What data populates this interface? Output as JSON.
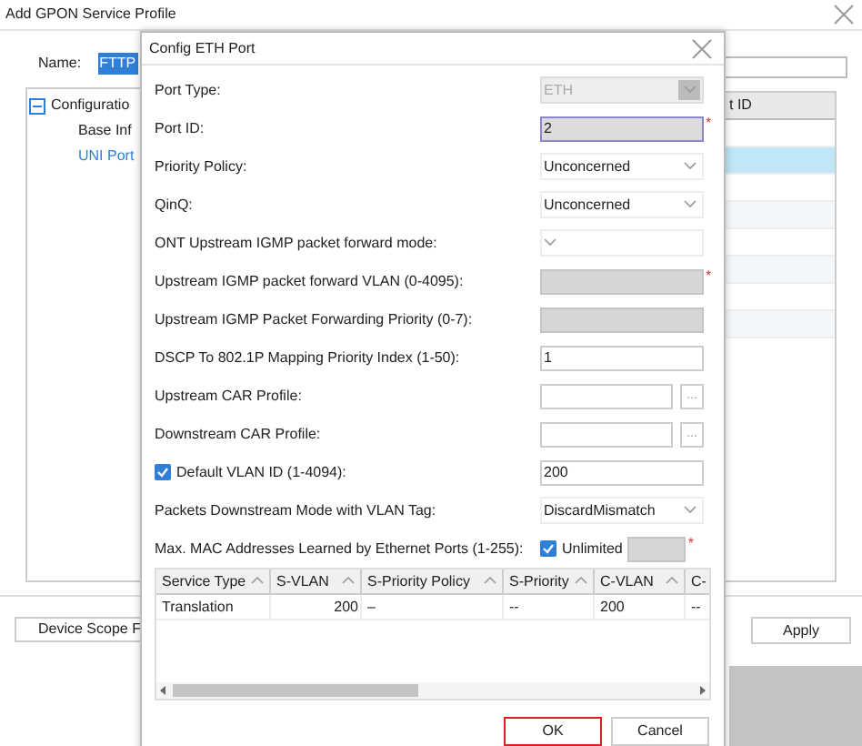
{
  "window": {
    "title": "Add GPON Service Profile"
  },
  "name_field": {
    "label": "Name:",
    "value": "FTTP",
    "selected": true
  },
  "tree": {
    "items": [
      {
        "label": "Configuratio",
        "expanded": true,
        "children": [
          {
            "label": "Base Inf",
            "selected": false
          },
          {
            "label": "UNI Port",
            "selected": true
          }
        ]
      }
    ]
  },
  "port_table": {
    "columns": [
      "t ID"
    ],
    "rows": [
      {
        "selected": false
      },
      {
        "selected": true
      },
      {
        "selected": false
      },
      {
        "selected": false
      },
      {
        "selected": false
      },
      {
        "selected": false
      },
      {
        "selected": false
      },
      {
        "selected": false
      }
    ]
  },
  "buttons": [
    {
      "label": "Device Scope F"
    },
    {
      "label": "Apply"
    }
  ],
  "dialog": {
    "title": "Config ETH Port",
    "fields": [
      {
        "kind": "select",
        "label": "Port Type:",
        "value": "ETH",
        "disabled": true
      },
      {
        "kind": "text",
        "label": "Port ID:",
        "value": "2",
        "disabled": false,
        "focused": true,
        "marker": "*"
      },
      {
        "kind": "select",
        "label": "Priority Policy:",
        "value": "Unconcerned",
        "disabled": false
      },
      {
        "kind": "select",
        "label": "QinQ:",
        "value": "Unconcerned",
        "disabled": false
      },
      {
        "kind": "select",
        "label": "ONT Upstream IGMP packet forward mode:",
        "disabled": false
      },
      {
        "kind": "text",
        "label": "Upstream IGMP packet forward VLAN (0-4095):",
        "disabled": true,
        "marker": "*"
      },
      {
        "kind": "text",
        "label": "Upstream IGMP Packet Forwarding Priority (0-7):",
        "disabled": true
      },
      {
        "kind": "text",
        "label": "DSCP To 802.1P Mapping Priority Index (1-50):",
        "value": "1",
        "disabled": false
      },
      {
        "kind": "browse",
        "label": "Upstream CAR Profile:",
        "button": "...",
        "disabled": false
      },
      {
        "kind": "browse",
        "label": "Downstream CAR Profile:",
        "button": "...",
        "disabled": false
      },
      {
        "kind": "text",
        "label": "Default VLAN ID (1-4094):",
        "value": "200",
        "disabled": false,
        "checked": true
      },
      {
        "kind": "select",
        "label": "Packets Downstream Mode with VLAN Tag:",
        "value": "DiscardMismatch",
        "disabled": false
      },
      {
        "kind": "unlimited",
        "label": "Max. MAC Addresses Learned by Ethernet Ports (1-255):",
        "option": "Unlimited",
        "checked": true,
        "disabled": true,
        "marker": "*"
      }
    ],
    "table": {
      "columns": [
        "Service Type",
        "S-VLAN",
        "S-Priority Policy",
        "S-Priority",
        "C-VLAN",
        "C-"
      ],
      "rows": [
        [
          "Translation",
          "200",
          "–",
          "--",
          "200",
          "--"
        ]
      ]
    },
    "buttons": [
      {
        "label": "OK",
        "focused": true
      },
      {
        "label": "Cancel",
        "focused": false
      }
    ]
  }
}
